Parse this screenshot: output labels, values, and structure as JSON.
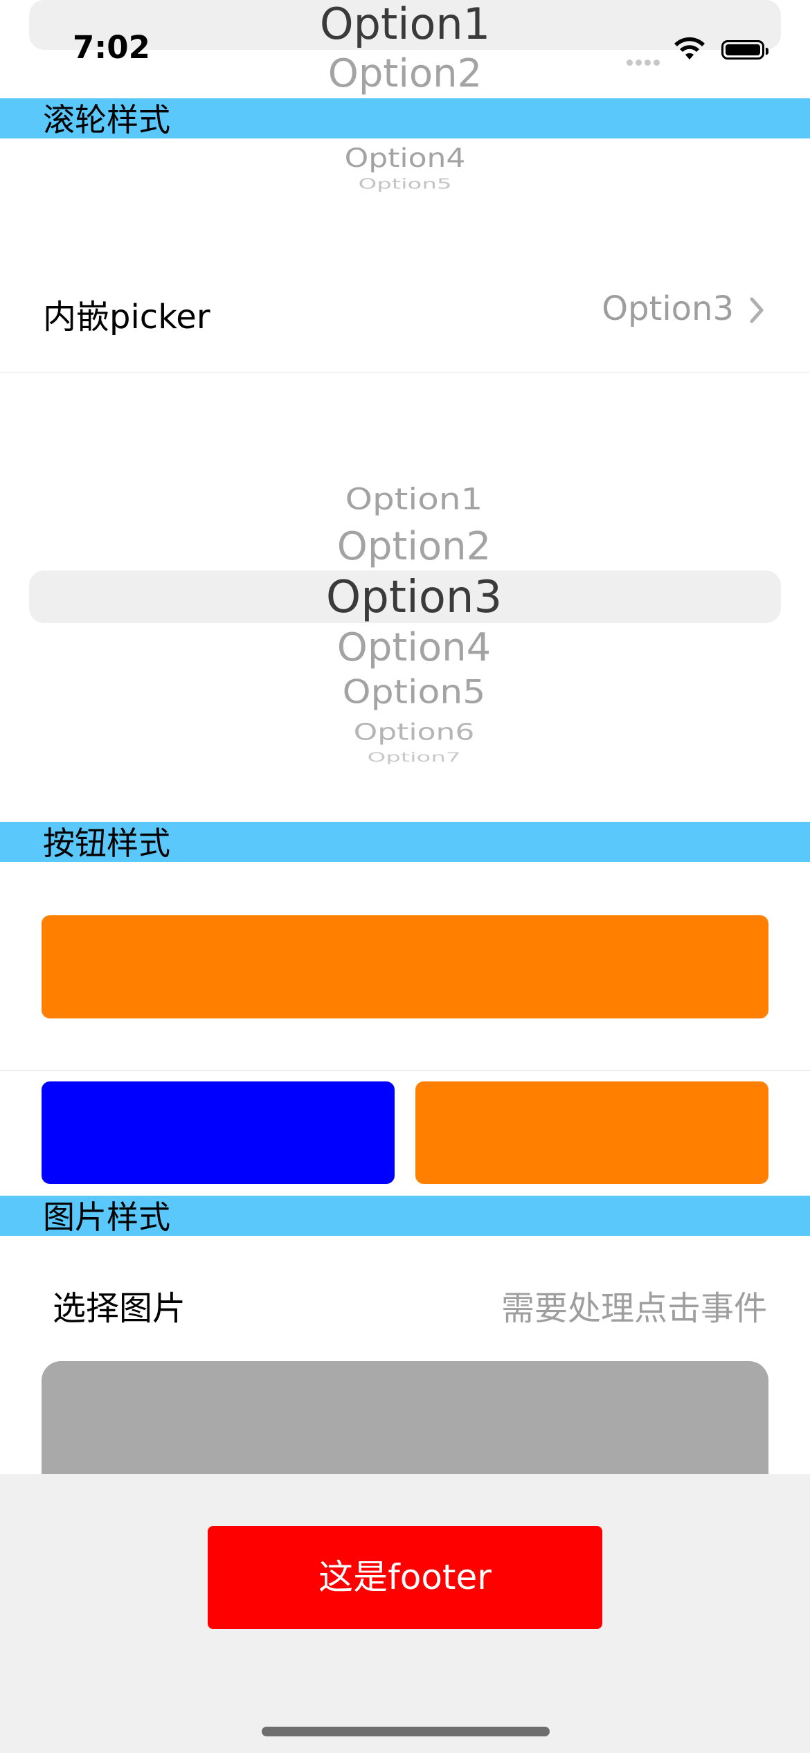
{
  "status_bar": {
    "time": "7:02"
  },
  "top_picker": {
    "options": [
      "Option1",
      "Option2",
      "Option4",
      "Option5"
    ]
  },
  "sections": {
    "wheel": "滚轮样式",
    "button": "按钮样式",
    "image": "图片样式"
  },
  "embedded_picker": {
    "label": "内嵌picker",
    "value": "Option3",
    "chevron": "chevron-right-icon"
  },
  "wheel_picker": {
    "options": [
      "Option1",
      "Option2",
      "Option3",
      "Option4",
      "Option5",
      "Option6",
      "Option7"
    ],
    "selected": "Option3"
  },
  "buttons": {
    "wide_color": "#ff7f00",
    "left_color": "#0000ff",
    "right_color": "#ff7f00"
  },
  "image_section": {
    "label": "选择图片",
    "hint": "需要处理点击事件",
    "placeholder_color": "#a9a9a9"
  },
  "footer": {
    "button_label": "这是footer",
    "button_color": "#ff0000"
  }
}
